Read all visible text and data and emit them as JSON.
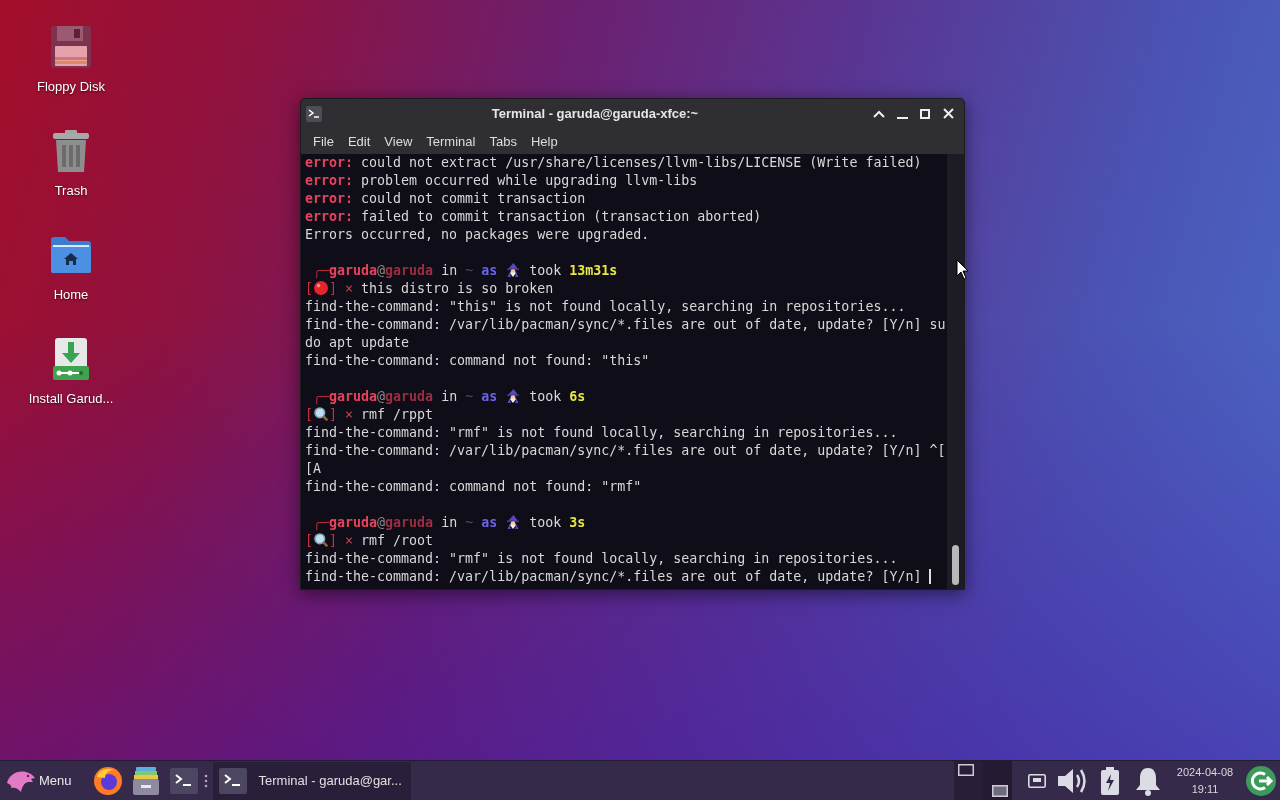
{
  "desktop": {
    "icons": [
      {
        "kind": "floppy",
        "label": "Floppy Disk"
      },
      {
        "kind": "trash",
        "label": "Trash"
      },
      {
        "kind": "home",
        "label": "Home"
      },
      {
        "kind": "installer",
        "label": "Install Garud..."
      }
    ]
  },
  "window": {
    "title": "Terminal - garuda@garuda-xfce:~",
    "menu": [
      "File",
      "Edit",
      "View",
      "Terminal",
      "Tabs",
      "Help"
    ],
    "terminal": {
      "cursor": true,
      "lines": [
        {
          "kind": "error",
          "tag": "error:",
          "text": "could not extract /usr/share/licenses/llvm-libs/LICENSE (Write failed)"
        },
        {
          "kind": "error",
          "tag": "error:",
          "text": "problem occurred while upgrading llvm-libs"
        },
        {
          "kind": "error",
          "tag": "error:",
          "text": "could not commit transaction"
        },
        {
          "kind": "error",
          "tag": "error:",
          "text": "failed to commit transaction (transaction aborted)"
        },
        {
          "kind": "text",
          "text": "Errors occurred, no packages were upgraded."
        },
        {
          "kind": "blank"
        },
        {
          "kind": "prompt",
          "corner": "╭─",
          "user": "garuda",
          "at": "@",
          "host": "garuda",
          "in": "in",
          "dir": "~",
          "as": "as",
          "took": "took",
          "duration": "13m31s"
        },
        {
          "kind": "command",
          "not_found": false,
          "open": "[",
          "close": "]",
          "mark": "×",
          "command": "this distro is so broken"
        },
        {
          "kind": "text",
          "text": "find-the-command: \"this\" is not found locally, searching in repositories..."
        },
        {
          "kind": "text",
          "text": "find-the-command: /var/lib/pacman/sync/*.files are out of date, update? [Y/n] su"
        },
        {
          "kind": "text",
          "text": "do apt update"
        },
        {
          "kind": "text",
          "text": "find-the-command: command not found: \"this\""
        },
        {
          "kind": "blank"
        },
        {
          "kind": "prompt",
          "corner": "╭─",
          "user": "garuda",
          "at": "@",
          "host": "garuda",
          "in": "in",
          "dir": "~",
          "as": "as",
          "took": "took",
          "duration": "6s"
        },
        {
          "kind": "command",
          "not_found": true,
          "open": "[",
          "close": "]",
          "mark": "×",
          "command": "rmf /rppt"
        },
        {
          "kind": "text",
          "text": "find-the-command: \"rmf\" is not found locally, searching in repositories..."
        },
        {
          "kind": "text",
          "text": "find-the-command: /var/lib/pacman/sync/*.files are out of date, update? [Y/n] ^["
        },
        {
          "kind": "text",
          "text": "[A"
        },
        {
          "kind": "text",
          "text": "find-the-command: command not found: \"rmf\""
        },
        {
          "kind": "blank"
        },
        {
          "kind": "prompt",
          "corner": "╭─",
          "user": "garuda",
          "at": "@",
          "host": "garuda",
          "in": "in",
          "dir": "~",
          "as": "as",
          "took": "took",
          "duration": "3s"
        },
        {
          "kind": "command",
          "not_found": true,
          "open": "[",
          "close": "]",
          "mark": "×",
          "command": "rmf /root"
        },
        {
          "kind": "text",
          "text": "find-the-command: \"rmf\" is not found locally, searching in repositories..."
        },
        {
          "kind": "text",
          "text": "find-the-command: /var/lib/pacman/sync/*.files are out of date, update? [Y/n]"
        }
      ]
    }
  },
  "taskbar": {
    "menu": {
      "label": "Menu"
    },
    "launchers": [
      {
        "kind": "browser"
      },
      {
        "kind": "files"
      },
      {
        "kind": "terminal"
      }
    ],
    "tasks": [
      {
        "label": "Terminal - garuda@gar...",
        "selected": true
      }
    ],
    "workspaces": [
      {
        "selected": false
      },
      {
        "selected": true
      }
    ],
    "clock": {
      "date": "2024-04-08",
      "time": "19:11"
    }
  }
}
